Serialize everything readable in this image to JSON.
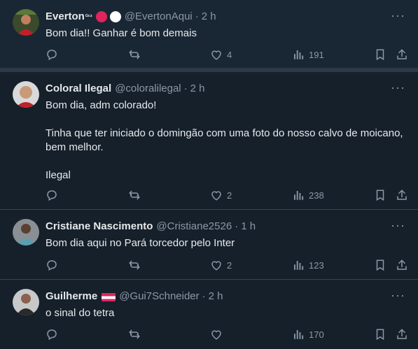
{
  "tweets": [
    {
      "name": "Everton",
      "name_suffix": "ᴳᶜᶻ",
      "handle": "@EvertonAqui",
      "time": "2 h",
      "text": "Bom dia!! Ganhar é bom demais",
      "likes": "4",
      "views": "191",
      "replies": "",
      "retweets": "",
      "badge_colors": [
        "#e0245e",
        "#ffffff"
      ]
    },
    {
      "name": "Coloral Ilegal",
      "handle": "@coloralilegal",
      "time": "2 h",
      "text": "Bom dia, adm colorado!\n\nTinha que ter iniciado o domingão com uma foto do nosso calvo de moicano,\nbem melhor.\n\nIlegal",
      "likes": "2",
      "views": "238",
      "replies": "",
      "retweets": ""
    },
    {
      "name": "Cristiane Nascimento",
      "handle": "@Cristiane2526",
      "time": "1 h",
      "text": "Bom dia aqui no Pará torcedor pelo Inter",
      "likes": "2",
      "views": "123",
      "replies": "",
      "retweets": ""
    },
    {
      "name": "Guilherme",
      "handle": "@Gui7Schneider",
      "time": "2 h",
      "text": "o sinal do tetra",
      "likes": "",
      "views": "170",
      "replies": "",
      "retweets": "",
      "flag_colors": [
        "#e0245e",
        "#ffffff",
        "#e0245e"
      ]
    }
  ],
  "common": {
    "dot": "·",
    "more": "···"
  },
  "colors": {
    "background": "#15202b",
    "text": "#e7e9ea",
    "muted": "#8b98a5",
    "border": "#38444d"
  }
}
